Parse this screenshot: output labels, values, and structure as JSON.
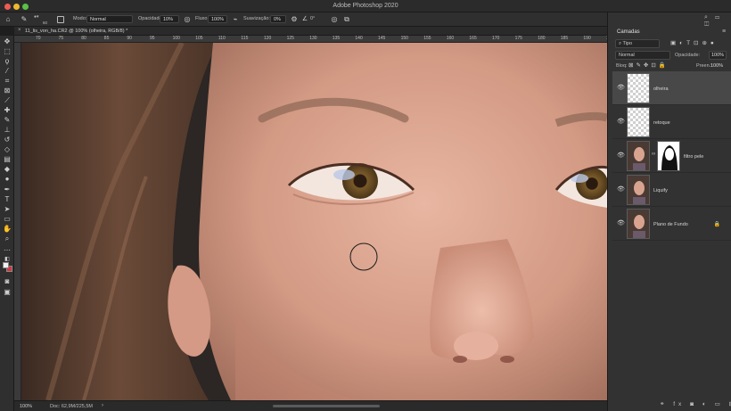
{
  "window": {
    "app_title": "Adobe Photoshop 2020"
  },
  "options_bar": {
    "brush_size": "60",
    "mode_label": "Modo:",
    "mode_value": "Normal",
    "opacity_label": "Opacidade:",
    "opacity_value": "10%",
    "flow_label": "Fluxo:",
    "flow_value": "100%",
    "smoothing_label": "Suavização:",
    "smoothing_value": "0%",
    "angle_value": "0°"
  },
  "document": {
    "tab_title": "11_lis_von_ha.CR2 @ 100% (olheira, RGB/8) *",
    "ruler_ticks": [
      "70",
      "75",
      "80",
      "85",
      "90",
      "95",
      "100",
      "105",
      "110",
      "115",
      "120",
      "125",
      "130",
      "135",
      "140",
      "145",
      "150",
      "155",
      "160",
      "165",
      "170",
      "175",
      "180",
      "185",
      "190",
      "195"
    ]
  },
  "status_bar": {
    "zoom": "100%",
    "doc_size": "Doc: 62,9M/225,5M"
  },
  "layers_panel": {
    "tab_label": "Camadas",
    "kind_filter": "Tipo",
    "blend_mode": "Normal",
    "opacity_label": "Opacidade:",
    "opacity_value": "100%",
    "lock_label": "Bloq:",
    "fill_label": "Preen.:",
    "fill_value": "100%",
    "layers": [
      {
        "name": "olheira",
        "thumb": "transparent",
        "selected": true
      },
      {
        "name": "retoque",
        "thumb": "transparent",
        "selected": false
      },
      {
        "name": "filtro pele",
        "thumb": "photo-with-mask",
        "selected": false
      },
      {
        "name": "Liquify",
        "thumb": "photo",
        "selected": false
      },
      {
        "name": "Plano de Fundo",
        "thumb": "photo",
        "selected": false,
        "locked": true
      }
    ]
  },
  "colors": {
    "foreground": "#f2f2f2",
    "background": "#d8343f",
    "panel_bg": "#323232",
    "selected_layer": "#484848"
  }
}
